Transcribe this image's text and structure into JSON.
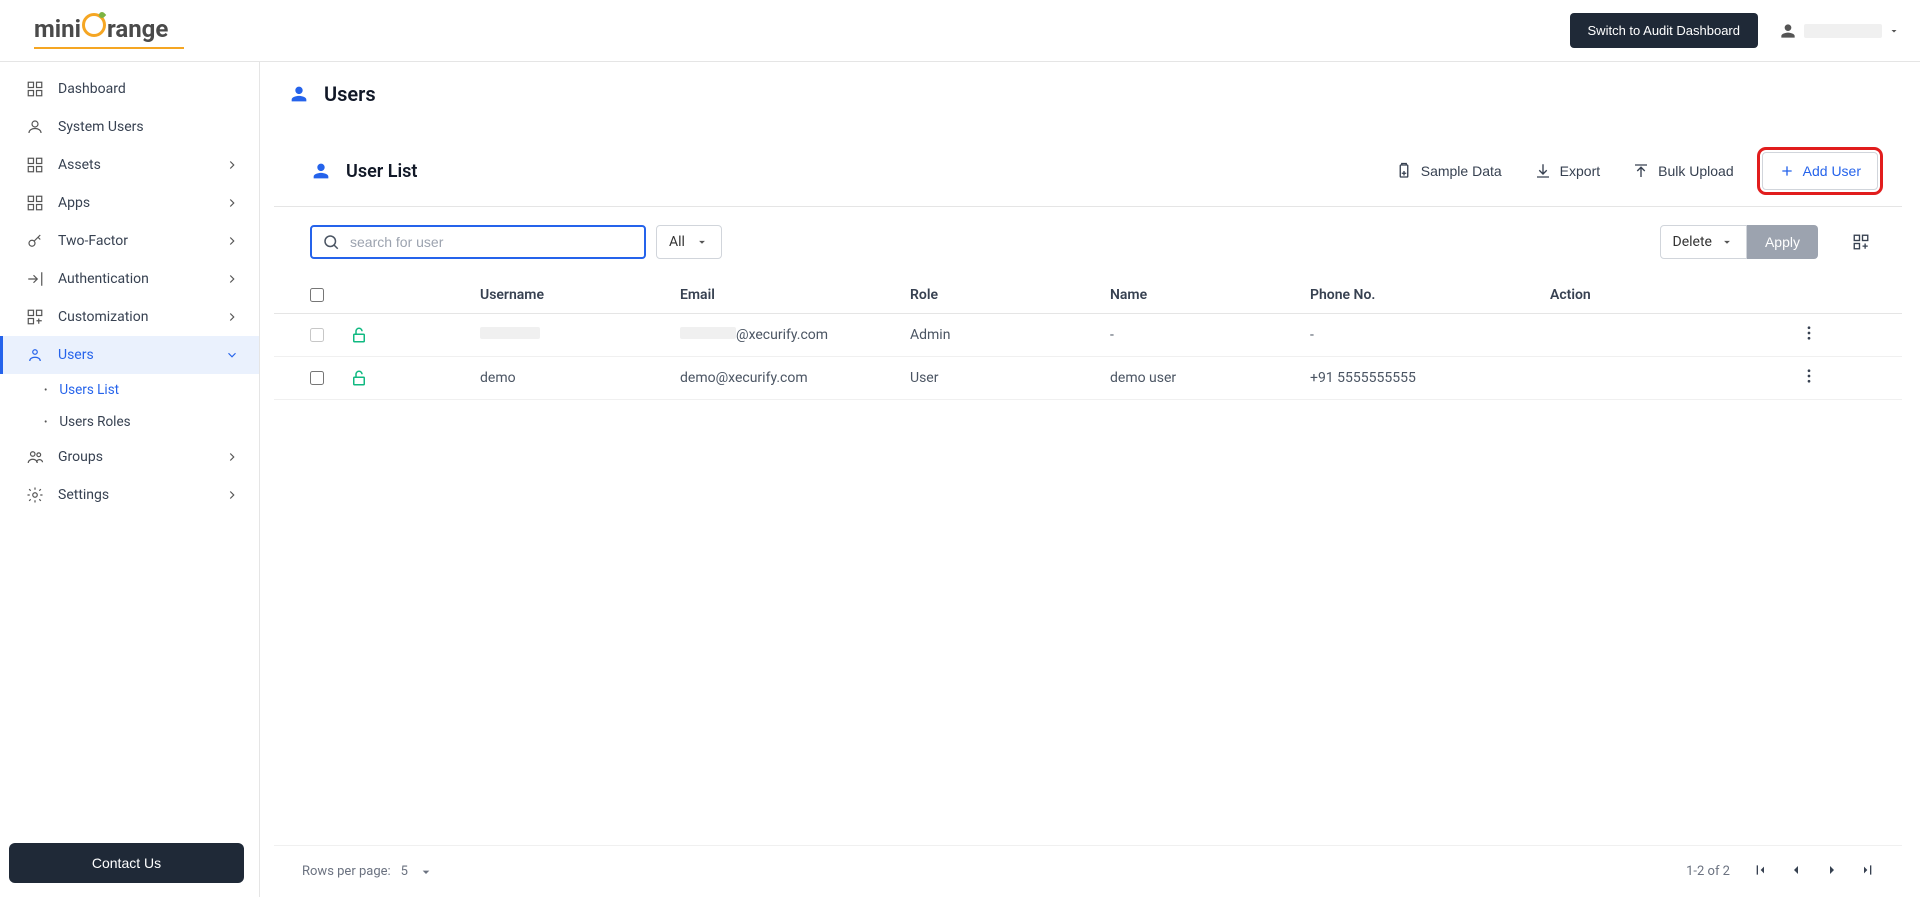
{
  "header": {
    "switch_label": "Switch to Audit Dashboard"
  },
  "sidebar": {
    "items": [
      {
        "label": "Dashboard"
      },
      {
        "label": "System Users"
      },
      {
        "label": "Assets"
      },
      {
        "label": "Apps"
      },
      {
        "label": "Two-Factor"
      },
      {
        "label": "Authentication"
      },
      {
        "label": "Customization"
      },
      {
        "label": "Users"
      },
      {
        "label": "Groups"
      },
      {
        "label": "Settings"
      }
    ],
    "sub": [
      {
        "label": "Users List"
      },
      {
        "label": "Users Roles"
      }
    ],
    "contact_label": "Contact Us"
  },
  "page": {
    "title": "Users",
    "card_title": "User List",
    "actions": {
      "sample_data": "Sample Data",
      "export": "Export",
      "bulk_upload": "Bulk Upload",
      "add_user": "Add User"
    },
    "search_placeholder": "search for user",
    "filter_all": "All",
    "delete_label": "Delete",
    "apply_label": "Apply"
  },
  "table": {
    "headers": {
      "username": "Username",
      "email": "Email",
      "role": "Role",
      "name": "Name",
      "phone": "Phone No.",
      "action": "Action"
    },
    "rows": [
      {
        "username_redacted": true,
        "email_suffix": "@xecurify.com",
        "role": "Admin",
        "name": "-",
        "phone": "-"
      },
      {
        "username": "demo",
        "email": "demo@xecurify.com",
        "role": "User",
        "name": "demo user",
        "phone": "+91 5555555555"
      }
    ]
  },
  "footer": {
    "rows_per_page_label": "Rows per page:",
    "rows_per_page_value": "5",
    "range": "1-2 of 2"
  }
}
